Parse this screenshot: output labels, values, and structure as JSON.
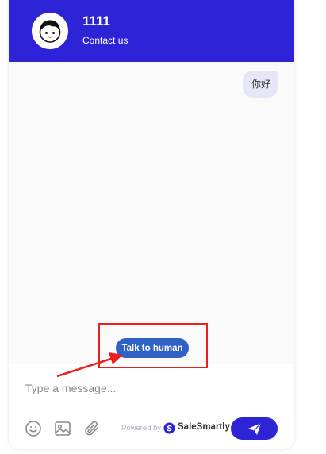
{
  "header": {
    "title": "1111",
    "subtitle": "Contact us",
    "avatar_icon": "cartoon-face-icon",
    "color": "#2c24d6"
  },
  "messages": [
    {
      "from": "user",
      "text": "你好"
    }
  ],
  "actions": {
    "talk_to_human_label": "Talk to human"
  },
  "composer": {
    "placeholder": "Type a message...",
    "tools": [
      "emoji-icon",
      "image-icon",
      "paperclip-icon"
    ],
    "powered_by_label": "Powered by",
    "brand_name": "SaleSmartly",
    "send_icon": "paper-plane-icon",
    "send_color": "#2c24d6"
  },
  "annotation": {
    "color": "#e8201f"
  }
}
